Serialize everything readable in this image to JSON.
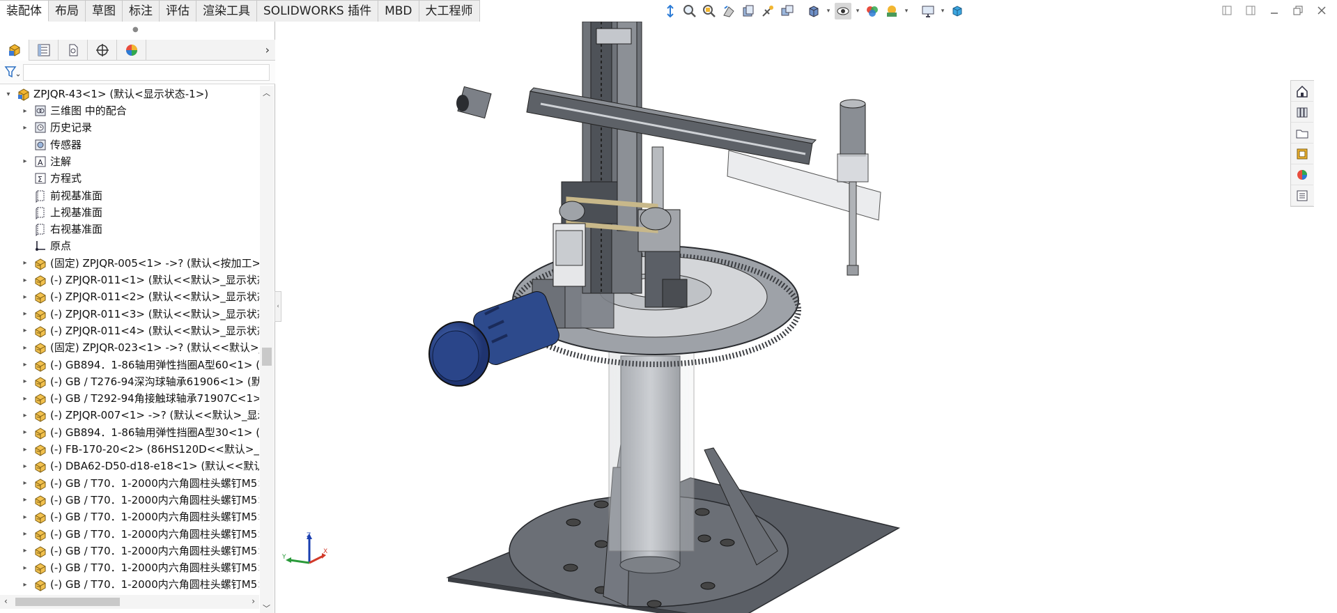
{
  "tabs": [
    "装配体",
    "布局",
    "草图",
    "标注",
    "评估",
    "渲染工具",
    "SOLIDWORKS 插件",
    "MBD",
    "大工程师"
  ],
  "active_tab": 0,
  "hud_icons": [
    "view-orientation-icon",
    "zoom-to-fit-icon",
    "zoom-area-icon",
    "previous-view-icon",
    "section-view-icon",
    "dynamic-annotation-icon",
    "view-palette-icon",
    "display-style-icon",
    "hide-show-icon",
    "edit-appearance-icon",
    "apply-scene-icon",
    "view-settings-icon",
    "3d-view-icon"
  ],
  "manager_tabs": [
    "featuremanager-icon",
    "propertymanager-icon",
    "configurationmanager-icon",
    "dimxpertmanager-icon",
    "displaymanager-icon"
  ],
  "tree": {
    "root": "ZPJQR-43<1> (默认<显示状态-1>)",
    "items": [
      {
        "label": "三维图 中的配合",
        "icon": "mates-icon",
        "expandable": true
      },
      {
        "label": "历史记录",
        "icon": "history-icon",
        "expandable": true
      },
      {
        "label": "传感器",
        "icon": "sensor-icon",
        "expandable": false
      },
      {
        "label": "注解",
        "icon": "annotation-icon",
        "expandable": true
      },
      {
        "label": "方程式",
        "icon": "equation-icon",
        "expandable": false
      },
      {
        "label": "前视基准面",
        "icon": "plane-icon",
        "expandable": false
      },
      {
        "label": "上视基准面",
        "icon": "plane-icon",
        "expandable": false
      },
      {
        "label": "右视基准面",
        "icon": "plane-icon",
        "expandable": false
      },
      {
        "label": "原点",
        "icon": "origin-icon",
        "expandable": false
      },
      {
        "label": "(固定) ZPJQR-005<1> ->? (默认<按加工><",
        "icon": "part-icon",
        "expandable": true
      },
      {
        "label": "(-) ZPJQR-011<1> (默认<<默认>_显示状态",
        "icon": "part-icon",
        "expandable": true
      },
      {
        "label": "(-) ZPJQR-011<2> (默认<<默认>_显示状态",
        "icon": "part-icon",
        "expandable": true
      },
      {
        "label": "(-) ZPJQR-011<3> (默认<<默认>_显示状态",
        "icon": "part-icon",
        "expandable": true
      },
      {
        "label": "(-) ZPJQR-011<4> (默认<<默认>_显示状态",
        "icon": "part-icon",
        "expandable": true
      },
      {
        "label": "(固定) ZPJQR-023<1> ->? (默认<<默认>_显",
        "icon": "part-icon",
        "expandable": true
      },
      {
        "label": "(-) GB894．1-86轴用弹性挡圈A型60<1> (默",
        "icon": "part-icon",
        "expandable": true
      },
      {
        "label": "(-) GB / T276-94深沟球轴承61906<1> (默认",
        "icon": "part-icon",
        "expandable": true
      },
      {
        "label": "(-) GB / T292-94角接触球轴承71907C<1> (",
        "icon": "part-icon",
        "expandable": true
      },
      {
        "label": "(-) ZPJQR-007<1> ->? (默认<<默认>_显示状",
        "icon": "part-icon",
        "expandable": true
      },
      {
        "label": "(-) GB894．1-86轴用弹性挡圈A型30<1> (默",
        "icon": "part-icon",
        "expandable": true
      },
      {
        "label": "(-) FB-170-20<2> (86HS120D<<默认>_显示",
        "icon": "part-icon",
        "expandable": true
      },
      {
        "label": "(-) DBA62-D50-d18-e18<1> (默认<<默认>_",
        "icon": "part-icon",
        "expandable": true
      },
      {
        "label": "(-) GB / T70．1-2000内六角圆柱头螺钉M5×",
        "icon": "part-icon",
        "expandable": true
      },
      {
        "label": "(-) GB / T70．1-2000内六角圆柱头螺钉M5×",
        "icon": "part-icon",
        "expandable": true
      },
      {
        "label": "(-) GB / T70．1-2000内六角圆柱头螺钉M5×",
        "icon": "part-icon",
        "expandable": true
      },
      {
        "label": "(-) GB / T70．1-2000内六角圆柱头螺钉M5×",
        "icon": "part-icon",
        "expandable": true
      },
      {
        "label": "(-) GB / T70．1-2000内六角圆柱头螺钉M5×",
        "icon": "part-icon",
        "expandable": true
      },
      {
        "label": "(-) GB / T70．1-2000内六角圆柱头螺钉M5×",
        "icon": "part-icon",
        "expandable": true
      },
      {
        "label": "(-) GB / T70．1-2000内六角圆柱头螺钉M5×",
        "icon": "part-icon",
        "expandable": true
      },
      {
        "label": "(-) GB / T70．1-2000内六角圆柱头螺钉M5×",
        "icon": "part-icon",
        "expandable": true
      }
    ]
  },
  "triad": {
    "z": "Z",
    "y": "Y",
    "x": "X"
  },
  "taskpane_icons": [
    "solidworks-resources-icon",
    "design-library-icon",
    "file-explorer-icon",
    "view-palette-icon",
    "appearances-icon",
    "custom-properties-icon"
  ],
  "colors": {
    "motor_blue": "#2d4a8c",
    "steel": "#8a8d92",
    "base_dark": "#5c6068",
    "belt": "#c8b88a"
  }
}
